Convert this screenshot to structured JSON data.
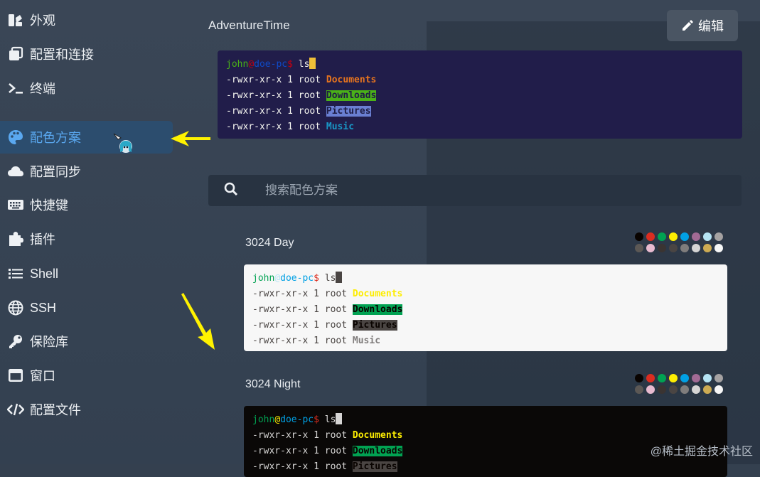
{
  "sidebar": {
    "items": [
      {
        "label": "外观",
        "icon": "appearance-icon"
      },
      {
        "label": "配置和连接",
        "icon": "profiles-icon"
      },
      {
        "label": "终端",
        "icon": "terminal-icon"
      },
      {
        "label": "配色方案",
        "icon": "palette-icon",
        "active": true
      },
      {
        "label": "配置同步",
        "icon": "cloud-icon"
      },
      {
        "label": "快捷键",
        "icon": "keyboard-icon"
      },
      {
        "label": "插件",
        "icon": "puzzle-icon"
      },
      {
        "label": "Shell",
        "icon": "list-icon"
      },
      {
        "label": "SSH",
        "icon": "globe-icon"
      },
      {
        "label": "保险库",
        "icon": "key-icon"
      },
      {
        "label": "窗口",
        "icon": "window-icon"
      },
      {
        "label": "配置文件",
        "icon": "code-icon"
      }
    ]
  },
  "main": {
    "current_scheme": "AdventureTime",
    "edit_label": "编辑",
    "search_placeholder": "搜索配色方案"
  },
  "preview": {
    "user": "john",
    "at": "@",
    "host": "doe-pc",
    "prompt": "$",
    "command": "ls",
    "perm": "-rwxr-xr-x",
    "links": "1",
    "owner": "root",
    "files": [
      "Documents",
      "Downloads",
      "Pictures",
      "Music"
    ]
  },
  "schemes": [
    {
      "name": "3024 Day",
      "colors": [
        "#090300",
        "#db2d20",
        "#01a252",
        "#fded02",
        "#01a0e4",
        "#a16a94",
        "#b5e4f4",
        "#a5a2a2",
        "#5c5855",
        "#e8bbd0",
        "#3a3432",
        "#4a4543",
        "#807d7c",
        "#d6d5d4",
        "#cdab53",
        "#f7f7f7"
      ]
    },
    {
      "name": "3024 Night",
      "colors": [
        "#090300",
        "#db2d20",
        "#01a252",
        "#fded02",
        "#01a0e4",
        "#a16a94",
        "#b5e4f4",
        "#a5a2a2",
        "#5c5855",
        "#e8bbd0",
        "#3a3432",
        "#4a4543",
        "#807d7c",
        "#d6d5d4",
        "#cdab53",
        "#f7f7f7"
      ]
    }
  ],
  "watermark": "@稀土掘金技术社区"
}
